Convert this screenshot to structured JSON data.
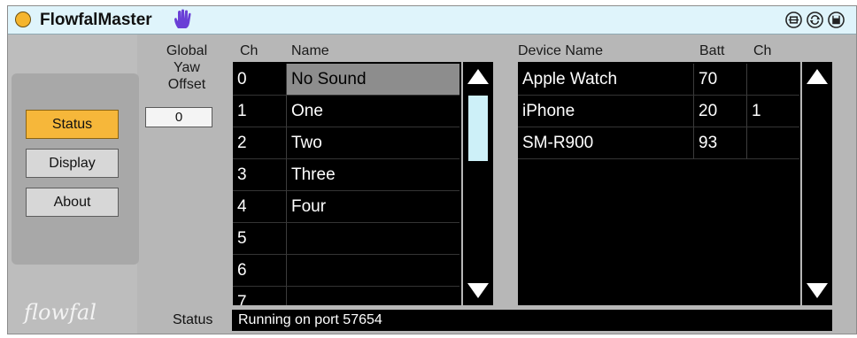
{
  "title": "FlowfalMaster",
  "colors": {
    "accent": "#f6b73a",
    "titlebar": "#dff4fb",
    "hand": "#6a3fd6",
    "scroll_thumb": "#cdf0f8"
  },
  "titlebar_icons": [
    "freeze-icon",
    "refresh-icon",
    "save-icon"
  ],
  "nav": [
    {
      "label": "Status",
      "active": true
    },
    {
      "label": "Display",
      "active": false
    },
    {
      "label": "About",
      "active": false
    }
  ],
  "logo": "flowfal",
  "global_yaw": {
    "label_line1": "Global",
    "label_line2": "Yaw",
    "label_line3": "Offset",
    "value": "0"
  },
  "channels": {
    "headers": {
      "ch": "Ch",
      "name": "Name"
    },
    "rows": [
      {
        "ch": "0",
        "name": "No Sound",
        "selected": true
      },
      {
        "ch": "1",
        "name": "One"
      },
      {
        "ch": "2",
        "name": "Two"
      },
      {
        "ch": "3",
        "name": "Three"
      },
      {
        "ch": "4",
        "name": "Four"
      },
      {
        "ch": "5",
        "name": ""
      },
      {
        "ch": "6",
        "name": ""
      },
      {
        "ch": "7",
        "name": ""
      }
    ]
  },
  "devices": {
    "headers": {
      "name": "Device Name",
      "batt": "Batt",
      "ch": "Ch"
    },
    "rows": [
      {
        "name": "Apple Watch",
        "batt": "70",
        "ch": ""
      },
      {
        "name": "iPhone",
        "batt": "20",
        "ch": "1"
      },
      {
        "name": "SM-R900",
        "batt": "93",
        "ch": ""
      }
    ]
  },
  "status": {
    "label": "Status",
    "text": "Running on port 57654"
  }
}
